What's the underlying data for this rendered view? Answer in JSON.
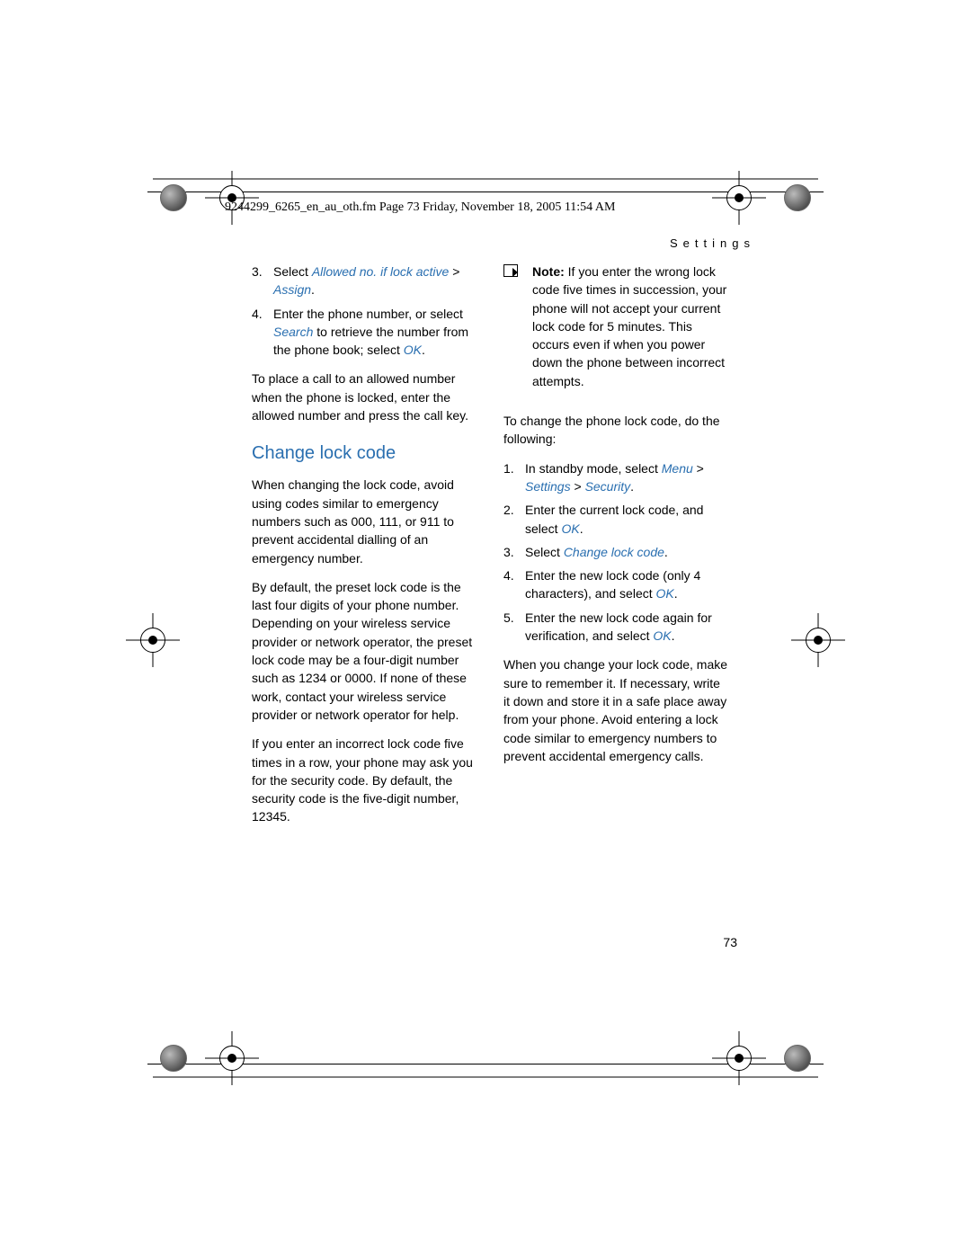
{
  "slug": "9244299_6265_en_au_oth.fm  Page 73  Friday, November 18, 2005  11:54 AM",
  "section_header": "Settings",
  "page_number": "73",
  "left": {
    "steps_a": [
      {
        "n": "3.",
        "pre": "Select ",
        "link": "Allowed no. if lock active",
        "mid": " > ",
        "link2": "Assign",
        "post": "."
      },
      {
        "n": "4.",
        "pre": "Enter the phone number, or select ",
        "link": "Search",
        "mid": " to retrieve the number from the phone book; select ",
        "link2": "OK",
        "post": "."
      }
    ],
    "para1": "To place a call to an allowed number when the phone is locked, enter the allowed number and press the call key.",
    "heading": "Change lock code",
    "para2": "When changing the lock code, avoid using codes similar to emergency numbers such as 000, 111, or 911 to prevent accidental dialling of an emergency number.",
    "para3": "By default, the preset lock code is the last four digits of your phone number. Depending on your wireless service provider or network operator, the preset lock code may be a four-digit number such as 1234 or 0000. If none of these work, contact your wireless service provider or network operator for help.",
    "para4": "If you enter an incorrect lock code five times in a row, your phone may ask you for the security code. By default, the security code is the five-digit number, 12345."
  },
  "right": {
    "note_label": "Note:",
    "note_body": " If you enter the wrong lock code five times in succession, your phone will not accept your current lock code for 5 minutes. This occurs even if when you power down the phone between incorrect attempts.",
    "para1": "To change the phone lock code, do the following:",
    "steps_b": [
      {
        "n": "1.",
        "pre": "In standby mode, select ",
        "link": "Menu",
        "mid": " > ",
        "link2": "Settings",
        "mid2": " > ",
        "link3": "Security",
        "post": "."
      },
      {
        "n": "2.",
        "pre": "Enter the current lock code, and select ",
        "link": "OK",
        "post": "."
      },
      {
        "n": "3.",
        "pre": "Select ",
        "link": "Change lock code",
        "post": "."
      },
      {
        "n": "4.",
        "pre": "Enter the new lock code (only 4 characters), and select ",
        "link": "OK",
        "post": "."
      },
      {
        "n": "5.",
        "pre": "Enter the new lock code again for verification, and select ",
        "link": "OK",
        "post": "."
      }
    ],
    "para2": "When you change your lock code, make sure to remember it. If necessary, write it down and store it in a safe place away from your phone. Avoid entering a lock code similar to emergency numbers to prevent accidental emergency calls."
  }
}
